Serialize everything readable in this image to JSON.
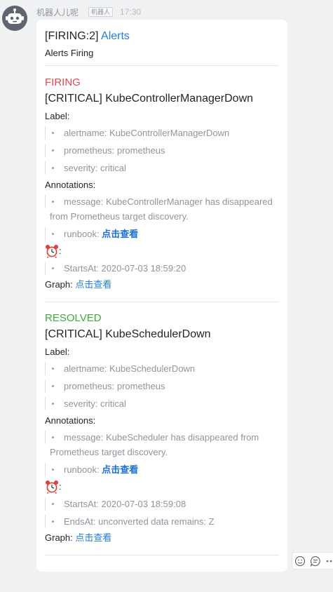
{
  "sender": {
    "name": "机器人儿呢",
    "badge": "机器人",
    "time": "17:30"
  },
  "card": {
    "title_prefix": "[FIRING:2]",
    "title_link": "Alerts",
    "subtitle": "Alerts Firing",
    "alerts": [
      {
        "status": "FIRING",
        "name": "[CRITICAL] KubeControllerManagerDown",
        "label_heading": "Label:",
        "labels": [
          "alertname: KubeControllerManagerDown",
          "prometheus: prometheus",
          "severity: critical"
        ],
        "annotations_heading": "Annotations:",
        "message": "message: KubeControllerManager has disappeared from Prometheus target discovery.",
        "runbook_prefix": "runbook: ",
        "runbook_link": "点击查看",
        "clock_suffix": ":",
        "times": [
          "StartsAt: 2020-07-03 18:59:20"
        ],
        "graph_label": "Graph:",
        "graph_link": "点击查看"
      },
      {
        "status": "RESOLVED",
        "name": "[CRITICAL] KubeSchedulerDown",
        "label_heading": "Label:",
        "labels": [
          "alertname: KubeSchedulerDown",
          "prometheus: prometheus",
          "severity: critical"
        ],
        "annotations_heading": "Annotations:",
        "message": "message: KubeScheduler has disappeared from Prometheus target discovery.",
        "runbook_prefix": "runbook: ",
        "runbook_link": "点击查看",
        "clock_suffix": ":",
        "times": [
          "StartsAt: 2020-07-03 18:59:08",
          "EndsAt: unconverted data remains: Z"
        ],
        "graph_label": "Graph:",
        "graph_link": "点击查看"
      }
    ]
  },
  "colors": {
    "firing": "#e5484d",
    "resolved": "#3eaa3a",
    "link": "#1f7de0"
  },
  "icons": {
    "avatar": "robot-icon",
    "clock": "alarm-clock-icon",
    "reactions": [
      "emoji-icon",
      "reply-icon",
      "more-icon"
    ]
  }
}
